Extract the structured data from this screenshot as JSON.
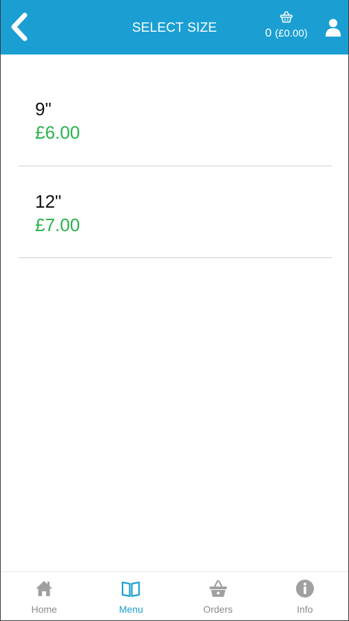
{
  "header": {
    "title": "SELECT SIZE",
    "cart_count": "0",
    "cart_total": "(£0.00)",
    "back_icon": "chevron-left-icon",
    "cart_icon": "basket-icon",
    "user_icon": "user-icon"
  },
  "sizes": [
    {
      "name": "9\"",
      "price": "£6.00"
    },
    {
      "name": "12\"",
      "price": "£7.00"
    }
  ],
  "tabbar": {
    "tabs": [
      {
        "label": "Home",
        "icon": "home-icon",
        "active": false
      },
      {
        "label": "Menu",
        "icon": "book-icon",
        "active": true
      },
      {
        "label": "Orders",
        "icon": "basket-icon",
        "active": false
      },
      {
        "label": "Info",
        "icon": "info-icon",
        "active": false
      }
    ]
  },
  "colors": {
    "header_bg": "#1b9fd3",
    "price": "#2ab24b",
    "active_tab": "#1b9fd3",
    "inactive_tab": "#8a8a8a"
  }
}
